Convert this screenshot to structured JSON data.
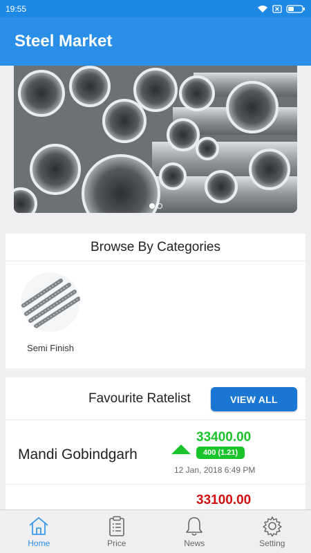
{
  "status_bar": {
    "time": "19:55"
  },
  "app_bar": {
    "title": "Steel Market"
  },
  "categories": {
    "title": "Browse By Categories",
    "items": [
      {
        "label": "Semi Finish",
        "icon": "rebar-icon"
      }
    ]
  },
  "ratelist": {
    "title": "Favourite Ratelist",
    "view_all_label": "VIEW ALL",
    "rows": [
      {
        "market": "Mandi Gobindgarh",
        "price": "33400.00",
        "change": "400 (1.21)",
        "time": "12 Jan, 2018 6:49 PM",
        "trend": "up"
      },
      {
        "market": "",
        "price": "33100.00",
        "trend": "down"
      }
    ]
  },
  "bottom_nav": {
    "items": [
      {
        "label": "Home",
        "icon": "home-icon",
        "active": true
      },
      {
        "label": "Price",
        "icon": "clipboard-icon"
      },
      {
        "label": "News",
        "icon": "bell-icon"
      },
      {
        "label": "Setting",
        "icon": "gear-icon"
      }
    ]
  },
  "colors": {
    "primary": "#2a8fe9",
    "button": "#1976d2",
    "up": "#19c42a",
    "down": "#d10f0f"
  }
}
